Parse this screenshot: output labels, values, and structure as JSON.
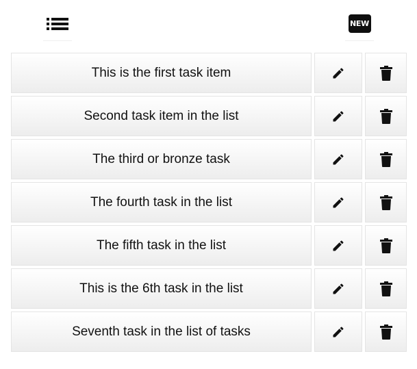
{
  "toolbar": {
    "list_icon": "list-icon",
    "new_badge_text": "NEW"
  },
  "tasks": [
    {
      "label": "This is the first task item"
    },
    {
      "label": "Second task item in the list"
    },
    {
      "label": "The third or bronze task"
    },
    {
      "label": "The fourth task in the list"
    },
    {
      "label": "The fifth task in the list"
    },
    {
      "label": "This is the 6th task in the list"
    },
    {
      "label": "Seventh task in the list of tasks"
    }
  ],
  "row_icons": {
    "edit": "pencil-icon",
    "delete": "trash-icon"
  },
  "colors": {
    "icon": "#111111",
    "row_border": "#e4e4e4",
    "row_gradient_top": "#ffffff",
    "row_gradient_bottom": "#ededed"
  }
}
